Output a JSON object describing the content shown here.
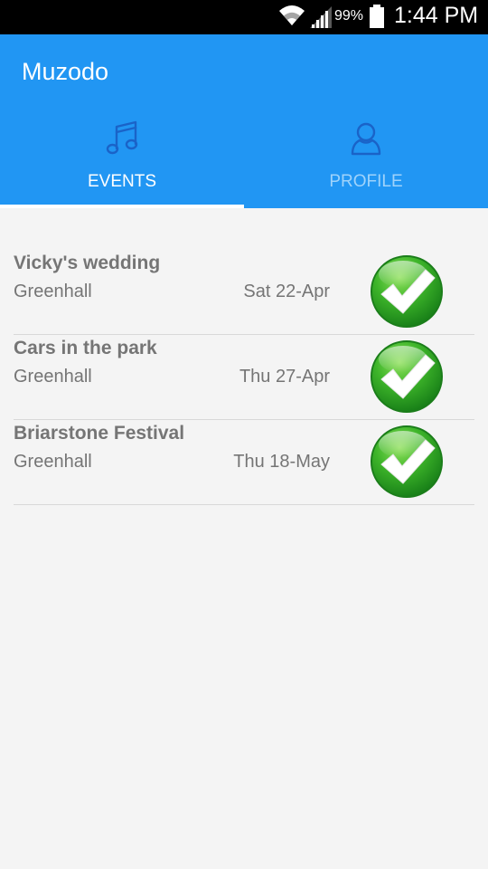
{
  "status_bar": {
    "battery_percent": "99%",
    "time": "1:44 PM",
    "icons": [
      "wifi-icon",
      "signal-icon",
      "battery-icon"
    ]
  },
  "app": {
    "title": "Muzodo",
    "accent_color": "#2196f3"
  },
  "tabs": [
    {
      "label": "EVENTS",
      "icon": "music-note-icon",
      "selected": true
    },
    {
      "label": "PROFILE",
      "icon": "person-icon",
      "selected": false
    }
  ],
  "events": [
    {
      "name": "Vicky's wedding",
      "venue": "Greenhall",
      "date": "Sat 22-Apr",
      "status_icon": "check-icon"
    },
    {
      "name": "Cars in the park",
      "venue": "Greenhall",
      "date": "Thu 27-Apr",
      "status_icon": "check-icon"
    },
    {
      "name": "Briarstone Festival",
      "venue": "Greenhall",
      "date": "Thu 18-May",
      "status_icon": "check-icon"
    }
  ]
}
